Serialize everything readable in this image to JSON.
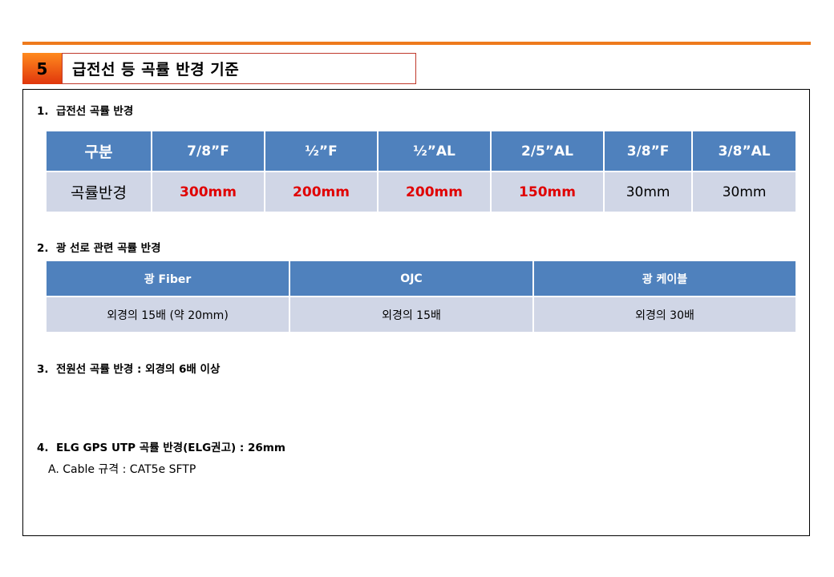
{
  "section": {
    "number": "5",
    "title": "급전선 등 곡률 반경 기준"
  },
  "items": [
    {
      "number": "1.",
      "heading": "급전선 곡률 반경"
    },
    {
      "number": "2.",
      "heading": "광 선로 관련 곡률 반경"
    },
    {
      "number": "3.",
      "heading": "전원선 곡률 반경 : 외경의 6배 이상"
    },
    {
      "number": "4.",
      "heading": "ELG GPS UTP 곡률 반경(ELG권고) : 26mm"
    }
  ],
  "item4_sub": "A.  Cable 규격 : CAT5e SFTP",
  "table1": {
    "headers": [
      "구분",
      "7/8”F",
      "½”F",
      "½”AL",
      "2/5”AL",
      "3/8”F",
      "3/8”AL"
    ],
    "row": [
      "곡률반경",
      "300mm",
      "200mm",
      "200mm",
      "150mm",
      "30mm",
      "30mm"
    ],
    "highlight_color": "#e00000"
  },
  "table2": {
    "headers": [
      "광 Fiber",
      "OJC",
      "광 케이블"
    ],
    "row": [
      "외경의 15배 (약 20mm)",
      "외경의 15배",
      "외경의 30배"
    ]
  },
  "colors": {
    "accent_line": "#ee7a1c",
    "header_blue": "#4f81bd",
    "cell_gray": "#d0d6e6"
  }
}
